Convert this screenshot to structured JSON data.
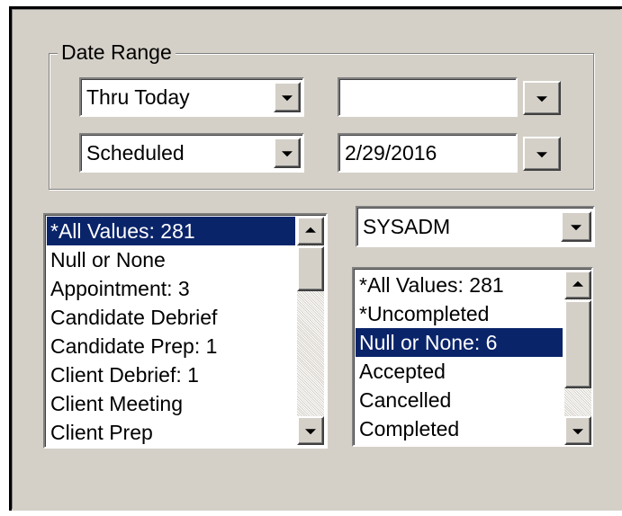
{
  "date_range": {
    "legend": "Date Range",
    "range_select": "Thru Today",
    "range_date": "",
    "type_select": "Scheduled",
    "type_date": "2/29/2016"
  },
  "activity_types": {
    "items": [
      {
        "label": "*All Values: 281",
        "selected": true
      },
      {
        "label": "Null or None",
        "selected": false
      },
      {
        "label": "Appointment: 3",
        "selected": false
      },
      {
        "label": "Candidate Debrief",
        "selected": false
      },
      {
        "label": "Candidate Prep: 1",
        "selected": false
      },
      {
        "label": "Client Debrief: 1",
        "selected": false
      },
      {
        "label": "Client Meeting",
        "selected": false
      },
      {
        "label": "Client Prep",
        "selected": false
      }
    ]
  },
  "owner": {
    "select_value": "SYSADM"
  },
  "status": {
    "items": [
      {
        "label": "*All Values: 281",
        "selected": false
      },
      {
        "label": "*Uncompleted",
        "selected": false
      },
      {
        "label": "Null or None: 6",
        "selected": true
      },
      {
        "label": "Accepted",
        "selected": false
      },
      {
        "label": "Cancelled",
        "selected": false
      },
      {
        "label": "Completed",
        "selected": false
      }
    ]
  },
  "colors": {
    "selection": "#0a246a",
    "panel": "#d4d0c8"
  },
  "icons": {
    "dropdown": "chevron-down-icon",
    "scroll_up": "arrow-up-icon",
    "scroll_down": "arrow-down-icon"
  }
}
